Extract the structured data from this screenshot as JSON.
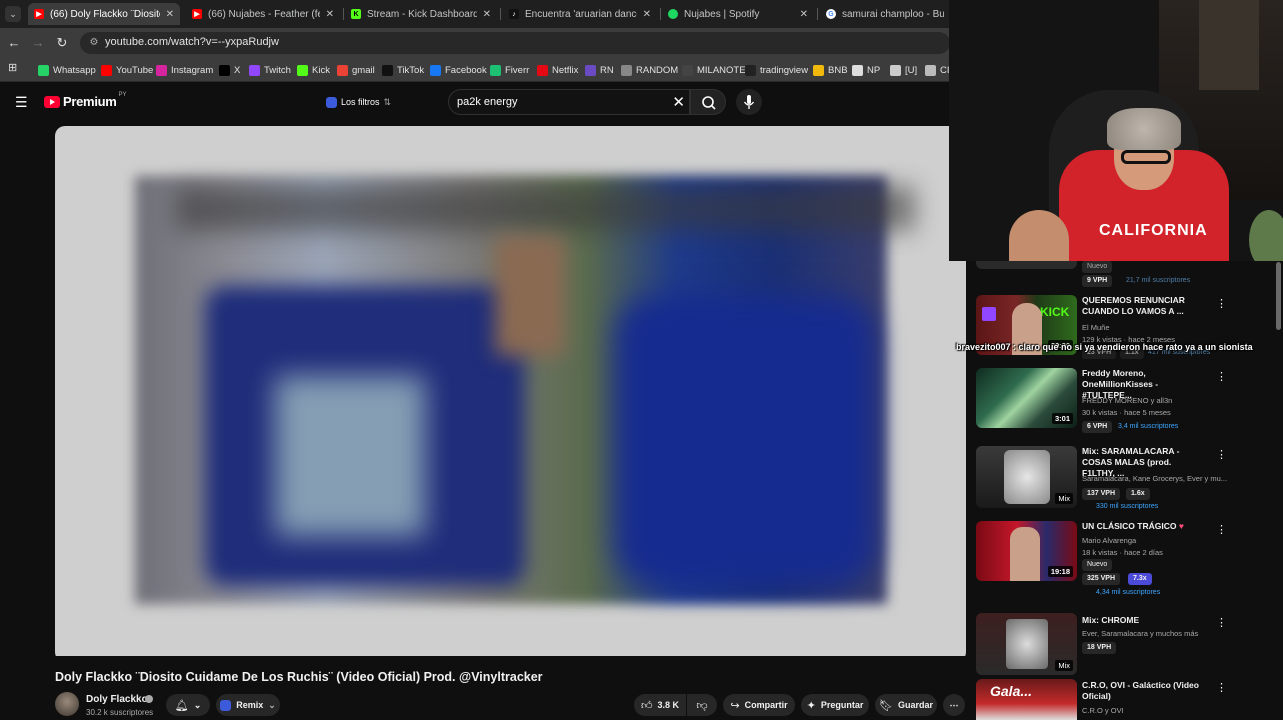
{
  "tabs": [
    {
      "title": "(66) Doly Flackko ¨Diosito Cuid",
      "favicon": "youtube",
      "active": true
    },
    {
      "title": "(66) Nujabes - Feather (feat. Ci",
      "favicon": "youtube",
      "active": false
    },
    {
      "title": "Stream - Kick Dashboard",
      "favicon": "kick",
      "active": false
    },
    {
      "title": "Encuentra 'aruarian dance' en T",
      "favicon": "tiktok",
      "active": false
    },
    {
      "title": "Nujabes | Spotify",
      "favicon": "spotify",
      "active": false
    },
    {
      "title": "samurai champloo - Buscar co",
      "favicon": "google",
      "active": false
    }
  ],
  "address": {
    "url": "youtube.com/watch?v=--yxpaRudjw"
  },
  "bookmarks": [
    {
      "label": "Whatsapp",
      "icon": "whatsapp-icon",
      "color": "#25d366"
    },
    {
      "label": "YouTube",
      "icon": "youtube-icon",
      "color": "#ff0000"
    },
    {
      "label": "Instagram",
      "icon": "instagram-icon",
      "color": "#d6249f"
    },
    {
      "label": "X",
      "icon": "x-icon",
      "color": "#000000"
    },
    {
      "label": "Twitch",
      "icon": "twitch-icon",
      "color": "#9146ff"
    },
    {
      "label": "Kick",
      "icon": "kick-icon",
      "color": "#53fc18"
    },
    {
      "label": "gmail",
      "icon": "gmail-icon",
      "color": "#ea4335"
    },
    {
      "label": "TikTok",
      "icon": "tiktok-icon",
      "color": "#111111"
    },
    {
      "label": "Facebook",
      "icon": "facebook-icon",
      "color": "#1877f2"
    },
    {
      "label": "Fiverr",
      "icon": "fiverr-icon",
      "color": "#1dbf73"
    },
    {
      "label": "Netflix",
      "icon": "netflix-icon",
      "color": "#e50914"
    },
    {
      "label": "RN",
      "icon": "rn-icon",
      "color": "#6a4bc4"
    },
    {
      "label": "RANDOM",
      "icon": "random-icon",
      "color": "#888888"
    },
    {
      "label": "MILANOTE",
      "icon": "milanote-icon",
      "color": "#444444"
    },
    {
      "label": "tradingview",
      "icon": "tradingview-icon",
      "color": "#222222"
    },
    {
      "label": "BNB",
      "icon": "bnb-icon",
      "color": "#f0b90b"
    },
    {
      "label": "NP",
      "icon": "np-icon",
      "color": "#dddddd"
    },
    {
      "label": "[U]",
      "icon": "u-icon",
      "color": "#cccccc"
    },
    {
      "label": "CII",
      "icon": "cii-icon",
      "color": "#bbbbbb"
    }
  ],
  "youtube": {
    "logo_text": "Premium",
    "logo_region": "PY",
    "filters_label": "Los filtros",
    "search_value": "pa2k energy"
  },
  "video": {
    "title": "Doly Flackko ¨Diosito Cuidame De Los Ruchis¨ (Video Oficial) Prod. @Vinyltracker",
    "channel": "Doly Flackko",
    "subscribers": "30.2 k suscriptores",
    "remix_label": "Remix",
    "likes": "3.8 K",
    "share_label": "Compartir",
    "ask_label": "Preguntar",
    "save_label": "Guardar"
  },
  "sidebar": [
    {
      "title": "",
      "meta1": "Nuevo",
      "tag_vph": "9 VPH",
      "subs": "21,7 mil suscriptores",
      "partial": true
    },
    {
      "title": "QUEREMOS RENUNCIAR CUANDO LO VAMOS A ...",
      "meta1": "El Muñe",
      "meta2": "129 k vistas · hace 2 meses",
      "tag_vph": "23 VPH",
      "tag_x": "1.1x",
      "subs": "417 mil suscriptores",
      "duration": "29:30"
    },
    {
      "title": "Freddy Moreno, OneMillionKisses - #TULTEPE...",
      "meta1": "FREDDY MORENO y all3n",
      "meta2": "30 k vistas · hace 5 meses",
      "tag_vph": "6 VPH",
      "subs": "3,4 mil suscriptores",
      "duration": "3:01"
    },
    {
      "title": "Mix: SARAMALACARA - COSAS MALAS (prod. F1LTHY, ...",
      "meta1": "Saramalacara, Kane Grocerys, Ever y mu...",
      "tag_vph": "137 VPH",
      "tag_x": "1.6x",
      "subs": "330 mil suscriptores",
      "duration": "Mix"
    },
    {
      "title": "UN CLÁSICO TRÁGICO",
      "meta1": "Mario Alvarenga",
      "meta2": "18 k vistas · hace 2 días",
      "meta3": "Nuevo",
      "tag_vph": "325 VPH",
      "tag_x": "7.3x",
      "subs": "4,34 mil suscriptores",
      "duration": "19:18"
    },
    {
      "title": "Mix: CHROME",
      "meta1": "Ever, Saramalacara y muchos más",
      "tag_vph": "18 VPH",
      "duration": "Mix"
    },
    {
      "title": "C.R.O, OVI - Galáctico (Video Oficial)",
      "meta1": "C.R.O y OVI"
    }
  ],
  "chat": {
    "user": "bravezito007",
    "message": "claro que no si ya vendieron hace rato ya a un sionista"
  },
  "webcam": {
    "shirt_text": "CALIFORNIA"
  }
}
